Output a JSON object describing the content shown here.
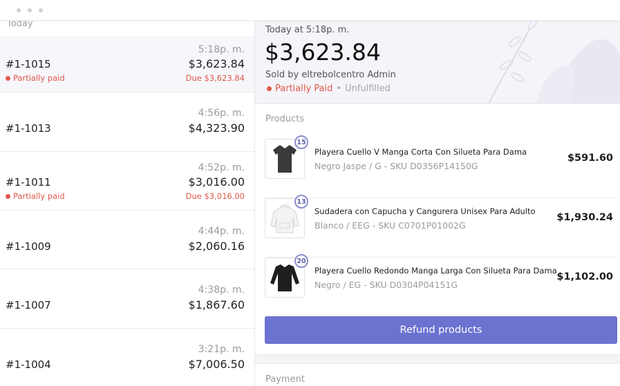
{
  "orders": {
    "section_label": "Today",
    "items": [
      {
        "number": "#1-1015",
        "time": "5:18p. m.",
        "amount": "$3,623.84",
        "status": "Partially paid",
        "due": "Due $3,623.84"
      },
      {
        "number": "#1-1013",
        "time": "4:56p. m.",
        "amount": "$4,323.90"
      },
      {
        "number": "#1-1011",
        "time": "4:52p. m.",
        "amount": "$3,016.00",
        "status": "Partially paid",
        "due": "Due $3,016.00"
      },
      {
        "number": "#1-1009",
        "time": "4:44p. m.",
        "amount": "$2,060.16"
      },
      {
        "number": "#1-1007",
        "time": "4:38p. m.",
        "amount": "$1,867.60"
      },
      {
        "number": "#1-1004",
        "time": "3:21p. m.",
        "amount": "$7,006.50"
      }
    ]
  },
  "detail": {
    "date": "Today at 5:18p. m.",
    "total": "$3,623.84",
    "sold_by": "Sold by eltrebolcentro Admin",
    "payment_status": "Partially Paid",
    "separator": "•",
    "fulfillment_status": "Unfulfilled",
    "products_label": "Products",
    "products": [
      {
        "qty": "15",
        "name": "Playera Cuello V Manga Corta Con Silueta Para Dama",
        "variant": "Negro Jaspe / G - SKU D0356P14150G",
        "price": "$591.60",
        "icon": "tshirt-icon"
      },
      {
        "qty": "13",
        "name": "Sudadera con Capucha y Cangurera Unisex Para Adulto",
        "variant": "Blanco / EEG - SKU C0701P01002G",
        "price": "$1,930.24",
        "icon": "hoodie-icon"
      },
      {
        "qty": "20",
        "name": "Playera Cuello Redondo Manga Larga Con Silueta Para Dama",
        "variant": "Negro / EG - SKU D0304P04151G",
        "price": "$1,102.00",
        "icon": "longsleeve-icon"
      }
    ],
    "refund_label": "Refund products",
    "payment_label": "Payment"
  },
  "colors": {
    "accent": "#6b72d0",
    "status_red": "#e0584a",
    "selected_row": "#f6f6fb"
  }
}
